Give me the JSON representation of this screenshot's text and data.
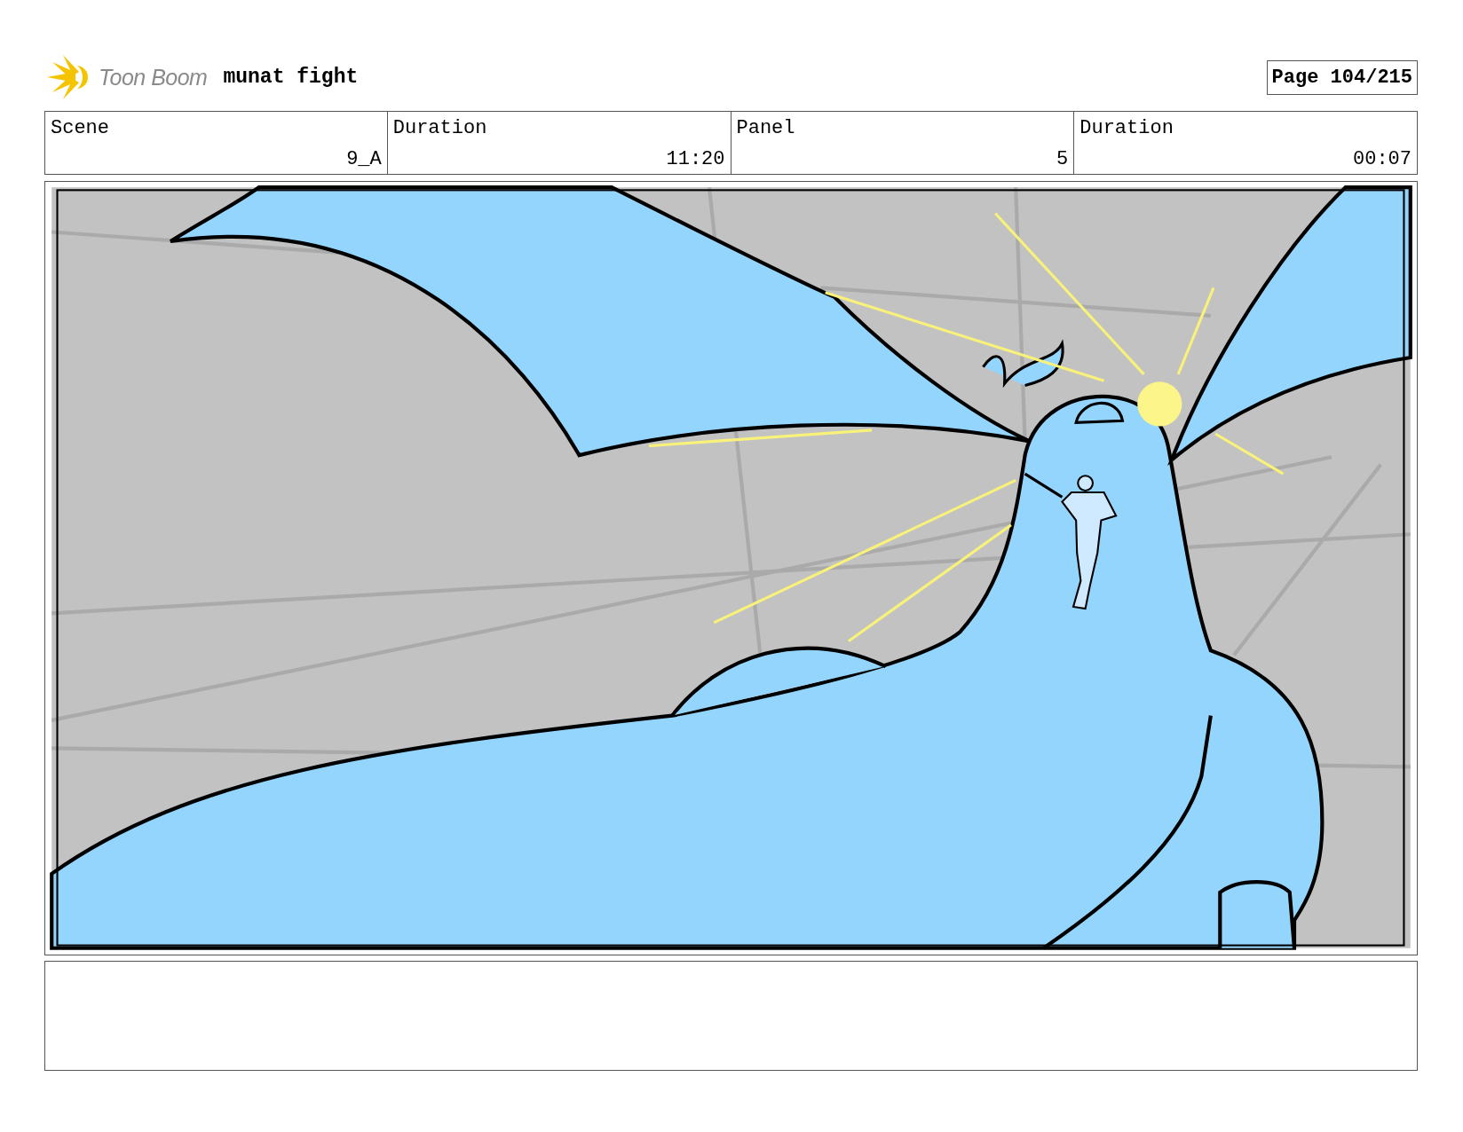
{
  "header": {
    "logo_text": "Toon Boom",
    "title": "munat fight",
    "page": "Page 104/215"
  },
  "info_table": {
    "columns": [
      "Scene",
      "Duration",
      "Panel",
      "Duration"
    ],
    "rows": [
      [
        "9_A",
        "11:20",
        "5",
        "00:07"
      ]
    ]
  }
}
